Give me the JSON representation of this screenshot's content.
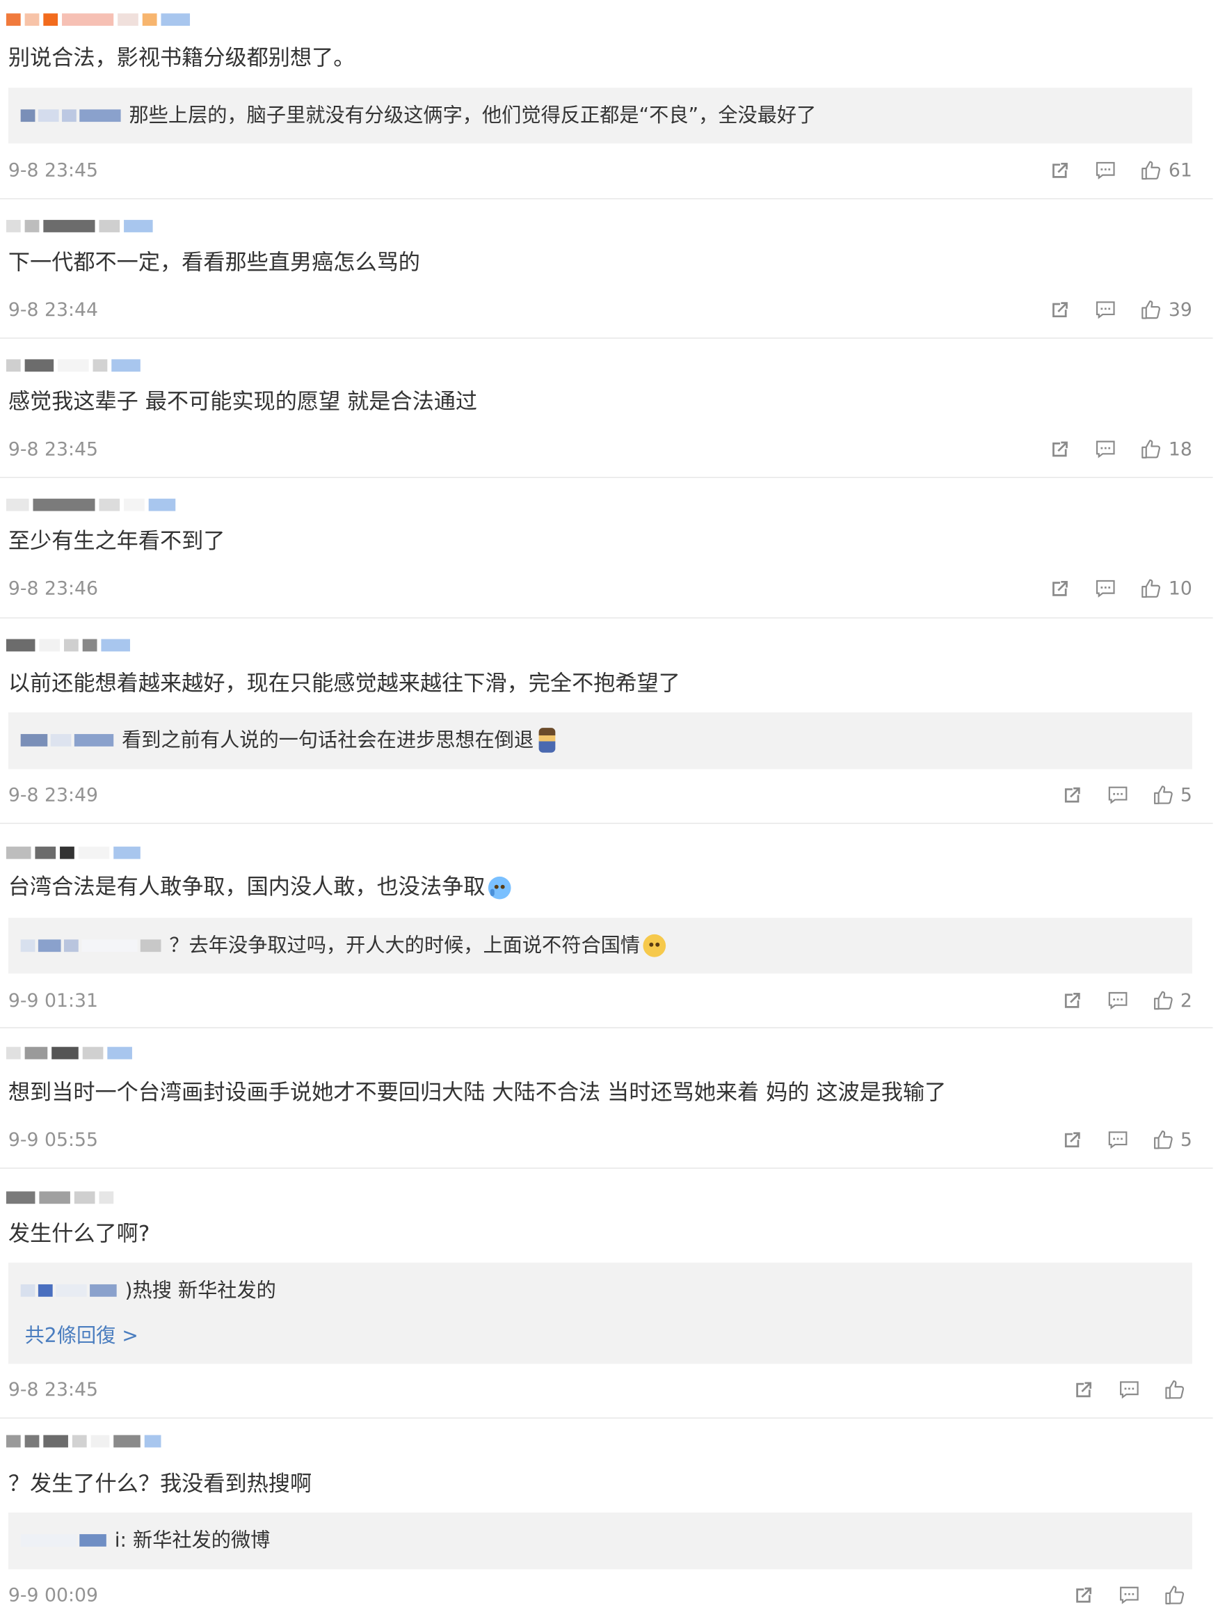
{
  "comments": [
    {
      "content": "别说合法，影视书籍分级都别想了。",
      "reply": "那些上层的，脑子里就没有分级这俩字，他们觉得反正都是“不良”，全没最好了",
      "time": "9-8 23:45",
      "likes": "61"
    },
    {
      "content": "下一代都不一定，看看那些直男癌怎么骂的",
      "time": "9-8 23:44",
      "likes": "39"
    },
    {
      "content": "感觉我这辈子 最不可能实现的愿望 就是合法通过",
      "time": "9-8 23:45",
      "likes": "18"
    },
    {
      "content": "至少有生之年看不到了",
      "time": "9-8 23:46",
      "likes": "10"
    },
    {
      "content": "以前还能想着越来越好，现在只能感觉越来越往下滑，完全不抱希望了",
      "reply": "看到之前有人说的一句话社会在进步思想在倒退",
      "time": "9-8 23:49",
      "likes": "5"
    },
    {
      "content": "台湾合法是有人敢争取，国内没人敢，也没法争取",
      "reply": "？去年没争取过吗，开人大的时候，上面说不符合国情",
      "time": "9-9 01:31",
      "likes": "2"
    },
    {
      "content": "想到当时一个台湾画封设画手说她才不要回归大陆 大陆不合法 当时还骂她来着 妈的 这波是我输了",
      "time": "9-9 05:55",
      "likes": "5"
    },
    {
      "content": "发生什么了啊?",
      "reply": ")热搜 新华社发的",
      "more_replies": "共2條回復 >",
      "time": "9-8 23:45",
      "likes": ""
    },
    {
      "content": "？发生了什么？我没看到热搜啊",
      "reply": "i: 新华社发的微博",
      "time": "9-9 00:09",
      "likes": ""
    }
  ],
  "icons": {
    "repost": "share-out-icon",
    "comment": "comment-icon",
    "like": "thumbs-up-icon",
    "emoji_figure": "figure-emoji-icon",
    "emoji_cry": "crying-emoji-icon",
    "emoji_smile": "smile-emoji-icon"
  },
  "colors": {
    "text": "#333333",
    "time": "#939393",
    "reply_bg": "#f2f2f2",
    "link": "#4a7dbf",
    "icon": "#8a8a8a"
  }
}
